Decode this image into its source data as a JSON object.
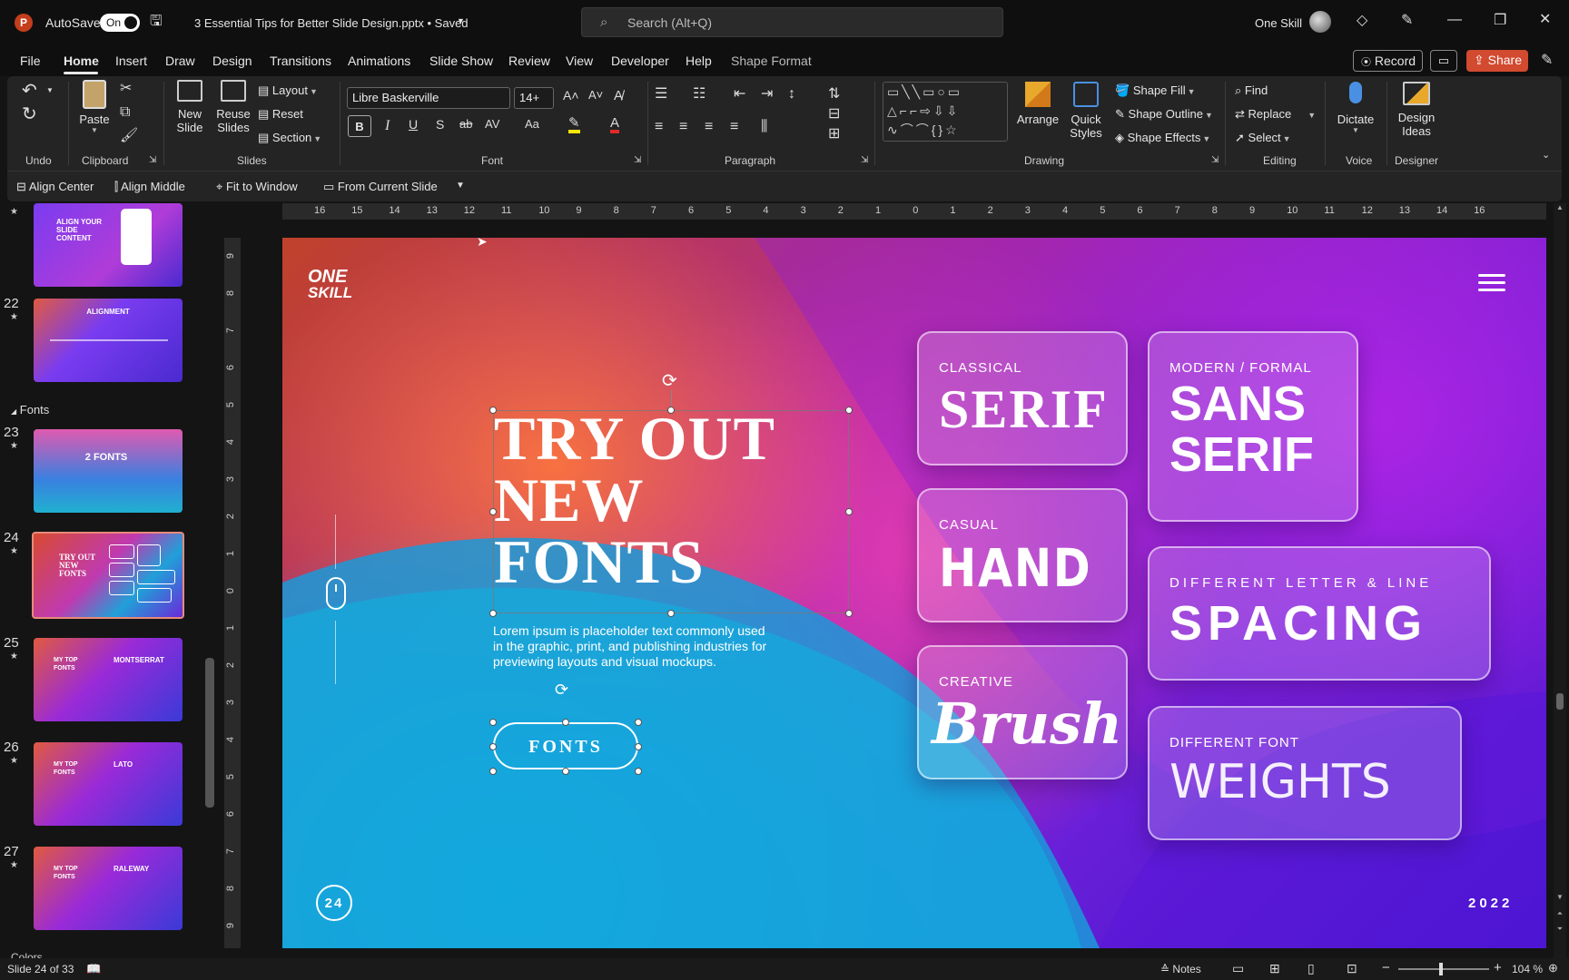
{
  "titlebar": {
    "autosave_label": "AutoSave",
    "autosave_state": "On",
    "doc_title": "3 Essential Tips for Better Slide Design.pptx • Saved",
    "search_placeholder": "Search (Alt+Q)",
    "user_name": "One Skill"
  },
  "menu": {
    "items": [
      "File",
      "Home",
      "Insert",
      "Draw",
      "Design",
      "Transitions",
      "Animations",
      "Slide Show",
      "Review",
      "View",
      "Developer",
      "Help",
      "Shape Format"
    ],
    "active": "Home",
    "record": "Record",
    "share": "Share"
  },
  "ribbon": {
    "groups": {
      "undo": "Undo",
      "clipboard": "Clipboard",
      "slides": "Slides",
      "font": "Font",
      "paragraph": "Paragraph",
      "drawing": "Drawing",
      "editing": "Editing",
      "voice": "Voice",
      "designer": "Designer"
    },
    "paste": "Paste",
    "new_slide": "New Slide",
    "reuse_slides": "Reuse Slides",
    "layout": "Layout",
    "reset": "Reset",
    "section": "Section",
    "font_name": "Libre Baskerville",
    "font_size": "14+",
    "arrange": "Arrange",
    "quick_styles": "Quick Styles",
    "shape_fill": "Shape Fill",
    "shape_outline": "Shape Outline",
    "shape_effects": "Shape Effects",
    "find": "Find",
    "replace": "Replace",
    "select": "Select",
    "dictate": "Dictate",
    "design_ideas": "Design Ideas"
  },
  "qat": {
    "align_center": "Align Center",
    "align_middle": "Align Middle",
    "fit_to_window": "Fit to Window",
    "from_current_slide": "From Current Slide"
  },
  "ruler_h": [
    "16",
    "15",
    "14",
    "13",
    "12",
    "11",
    "10",
    "9",
    "8",
    "7",
    "6",
    "5",
    "4",
    "3",
    "2",
    "1",
    "0",
    "1",
    "2",
    "3",
    "4",
    "5",
    "6",
    "7",
    "8",
    "9",
    "10",
    "11",
    "12",
    "13",
    "14",
    "16"
  ],
  "ruler_v": [
    "9",
    "8",
    "7",
    "6",
    "5",
    "4",
    "3",
    "2",
    "1",
    "0",
    "1",
    "2",
    "3",
    "4",
    "5",
    "6",
    "7",
    "8",
    "9"
  ],
  "thumbnails": {
    "section_name": "Fonts",
    "next_section": "Colors",
    "slides": [
      {
        "num": "",
        "text": "ALIGN YOUR SLIDE CONTENT"
      },
      {
        "num": "22",
        "text": "ALIGNMENT"
      },
      {
        "num": "23",
        "text": "2 FONTS"
      },
      {
        "num": "24",
        "text": "TRY OUT NEW FONTS"
      },
      {
        "num": "25",
        "text": "MONTSERRAT",
        "sub": "MY TOP FONTS"
      },
      {
        "num": "26",
        "text": "LATO",
        "sub": "MY TOP FONTS"
      },
      {
        "num": "27",
        "text": "RALEWAY",
        "sub": "MY TOP FONTS"
      }
    ]
  },
  "slide": {
    "logo_line1": "ONE",
    "logo_line2": "SKILL",
    "heading_line1": "TRY OUT",
    "heading_line2": "NEW",
    "heading_line3": "FONTS",
    "body": "Lorem ipsum is placeholder text commonly used in the graphic, print, and publishing industries for previewing layouts and visual mockups.",
    "button": "FONTS",
    "page_number": "24",
    "year": "2022",
    "cards": {
      "serif": {
        "small": "CLASSICAL",
        "big": "SERIF"
      },
      "sans": {
        "small": "MODERN / FORMAL",
        "big1": "SANS",
        "big2": "SERIF"
      },
      "hand": {
        "small": "CASUAL",
        "big": "HAND"
      },
      "spacing": {
        "small": "DIFFERENT LETTER & LINE",
        "big": "SPACING"
      },
      "brush": {
        "small": "CREATIVE",
        "big": "Brush"
      },
      "weights": {
        "small": "DIFFERENT FONT",
        "big": "WEIGHTS"
      }
    }
  },
  "status": {
    "slide_info": "Slide 24 of 33",
    "notes": "Notes",
    "zoom": "104 %"
  }
}
